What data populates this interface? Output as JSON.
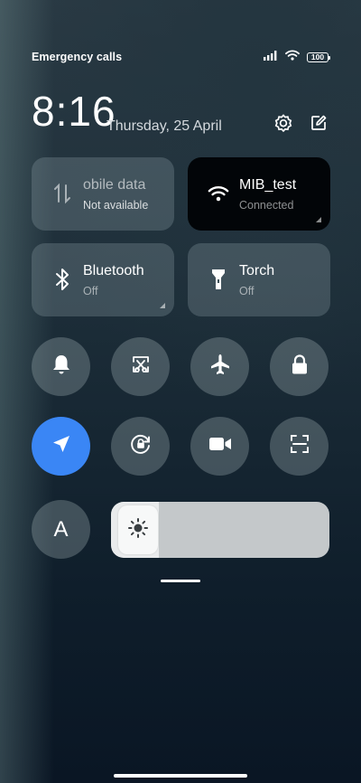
{
  "status_bar": {
    "carrier_text": "Emergency calls o",
    "battery_level": "100",
    "icons": [
      "signal-icon",
      "wifi-icon",
      "battery-icon"
    ]
  },
  "header": {
    "time": "8:16",
    "date": "Thursday, 25 April",
    "icons": [
      "settings-icon",
      "edit-icon"
    ]
  },
  "tiles": {
    "mobile_data": {
      "title": "obile data",
      "subtitle": "Not available",
      "icon": "mobile-data-icon"
    },
    "wifi": {
      "title": "MIB_test",
      "subtitle": "Connected",
      "icon": "wifi-icon"
    },
    "bluetooth": {
      "title": "Bluetooth",
      "subtitle": "Off",
      "icon": "bluetooth-icon"
    },
    "torch": {
      "title": "Torch",
      "subtitle": "Off",
      "icon": "torch-icon"
    }
  },
  "toggles": [
    {
      "icon": "bell-icon",
      "active": false
    },
    {
      "icon": "screenshot-icon",
      "active": false
    },
    {
      "icon": "airplane-icon",
      "active": false
    },
    {
      "icon": "lock-icon",
      "active": false
    },
    {
      "icon": "location-icon",
      "active": true
    },
    {
      "icon": "rotation-lock-icon",
      "active": false
    },
    {
      "icon": "video-icon",
      "active": false
    },
    {
      "icon": "scan-icon",
      "active": false
    }
  ],
  "auto_brightness": {
    "label": "A"
  },
  "brightness": {
    "level": 0.22,
    "icon": "sun-icon"
  },
  "colors": {
    "active_blue": "#3a86f5",
    "wifi_tile": "#020508"
  }
}
